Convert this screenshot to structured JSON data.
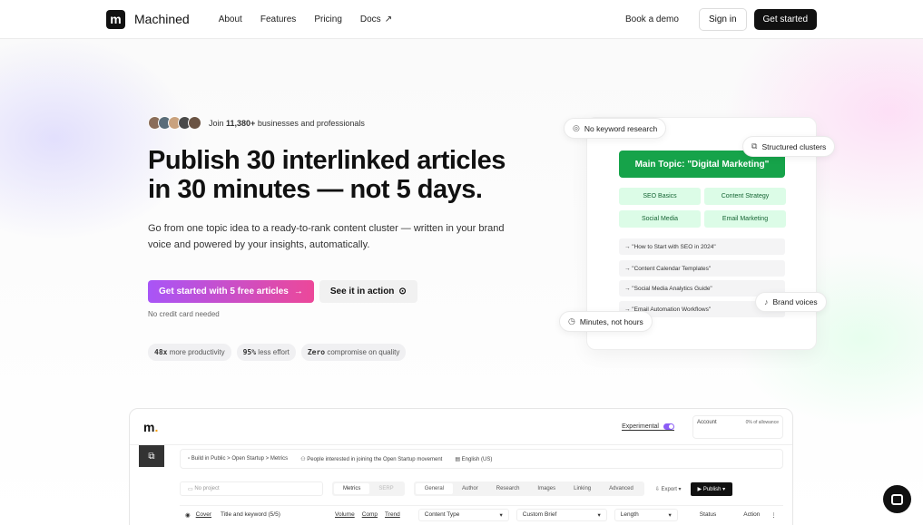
{
  "nav": {
    "brand": "Machined",
    "logo_letter": "m",
    "links": [
      "About",
      "Features",
      "Pricing",
      "Docs"
    ],
    "book_demo": "Book a demo",
    "sign_in": "Sign in",
    "get_started": "Get started"
  },
  "hero": {
    "social_prefix": "Join ",
    "social_count": "11,380+",
    "social_suffix": " businesses and professionals",
    "headline_1": "Publish 30 interlinked articles",
    "headline_2": "in 30 minutes — not 5 days.",
    "subtext": "Go from one topic idea to a ready-to-rank content cluster — written in your brand voice and powered by your insights, automatically.",
    "cta_primary": "Get started with 5 free articles",
    "cta_secondary": "See it in action",
    "no_cc": "No credit card needed",
    "pills": [
      {
        "value": "48x",
        "text": "more productivity"
      },
      {
        "value": "95%",
        "text": "less effort"
      },
      {
        "value": "Zero",
        "text": "compromise on quality"
      }
    ],
    "avatar_colors": [
      "#8a6d5a",
      "#5a6d7a",
      "#c9a27e",
      "#4a4a4a",
      "#6b5444"
    ]
  },
  "illustration": {
    "main_topic": "Main Topic: \"Digital Marketing\"",
    "subtopics": [
      "SEO Basics",
      "Content Strategy",
      "Social Media",
      "Email Marketing"
    ],
    "articles": [
      "→ \"How to Start with SEO in 2024\"",
      "→ \"Content Calendar Templates\"",
      "→ \"Social Media Analytics Guide\"",
      "→ \"Email Automation Workflows\""
    ],
    "tags": {
      "no_keyword": "No keyword research",
      "structured": "Structured clusters",
      "brand_voices": "Brand voices",
      "minutes": "Minutes, not hours"
    },
    "accent_green": "#16a34a"
  },
  "app": {
    "logo": "m",
    "logo_dot": ".",
    "experimental": "Experimental",
    "account_label": "Account",
    "account_value": "0% of allowance",
    "breadcrumb": "Build in Public > Open Startup > Metrics",
    "audience": "People interested in joining the Open Startup movement",
    "language": "English (US)",
    "no_project": "No project",
    "seg": [
      "Metrics",
      "SERP"
    ],
    "tabs": [
      "General",
      "Author",
      "Research",
      "Images",
      "Linking",
      "Advanced"
    ],
    "export": "Export",
    "publish": "Publish",
    "row": {
      "cover": "Cover",
      "title": "Title and keyword (5/5)",
      "volume": "Volume",
      "comp": "Comp",
      "trend": "Trend",
      "content_type": "Content Type",
      "custom_brief": "Custom Brief",
      "length": "Length",
      "status": "Status",
      "action": "Action"
    }
  }
}
